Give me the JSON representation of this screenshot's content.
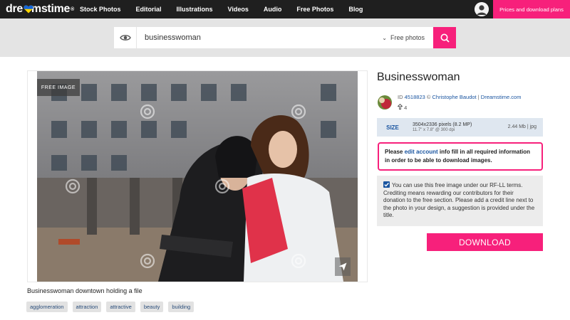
{
  "brand": {
    "logo_left": "dre",
    "logo_right": "mstime",
    "registered": "®",
    "heart_colors": [
      "#1565d8",
      "#ffd600"
    ]
  },
  "nav": {
    "items": [
      {
        "label": "Stock Photos"
      },
      {
        "label": "Editorial"
      },
      {
        "label": "Illustrations"
      },
      {
        "label": "Videos"
      },
      {
        "label": "Audio"
      },
      {
        "label": "Free Photos"
      },
      {
        "label": "Blog"
      }
    ],
    "plans_button": "Prices and download plans",
    "avatar_icon": "user-avatar-icon"
  },
  "search": {
    "query": "businesswoman",
    "filter_label": "Free photos",
    "filter_icon": "chevron-down-icon",
    "button_icon": "search-icon",
    "visibility_icon": "eye-icon"
  },
  "image": {
    "badge": "FREE IMAGE",
    "caption": "Businesswoman downtown holding a file",
    "share_icon": "send-icon",
    "watermark": "dreamstime"
  },
  "tags": [
    {
      "label": "agglomeration"
    },
    {
      "label": "attraction"
    },
    {
      "label": "attractive"
    },
    {
      "label": "beauty"
    },
    {
      "label": "building"
    }
  ],
  "details": {
    "title": "Businesswoman",
    "id_prefix": "ID",
    "id_value": "4518823",
    "copyright": "©",
    "author": "Christophe Baudot",
    "separator": "|",
    "site": "Dreamstime.com",
    "level_value": "4",
    "level_icon": "level-icon"
  },
  "size": {
    "label": "SIZE",
    "pixels": "3504x2336 pixels (8.2 MP)",
    "inches": "11.7\" x 7.8\" @ 300 dpi",
    "file": "2.44 Mb | jpg"
  },
  "warning": {
    "before": "Please ",
    "link": "edit account",
    "after": " info fill in all required information in order to be able to download images."
  },
  "license": {
    "checked": true,
    "text": "You can use this free image under our RF-LL terms. Crediting means rewarding our contributors for their donation to the free section. Please add a credit line next to the photo in your design, a suggestion is provided under the title."
  },
  "download_button": "DOWNLOAD",
  "colors": {
    "accent": "#f7207b",
    "nav_bg": "#1f1f1f",
    "link": "#1a55a0"
  }
}
